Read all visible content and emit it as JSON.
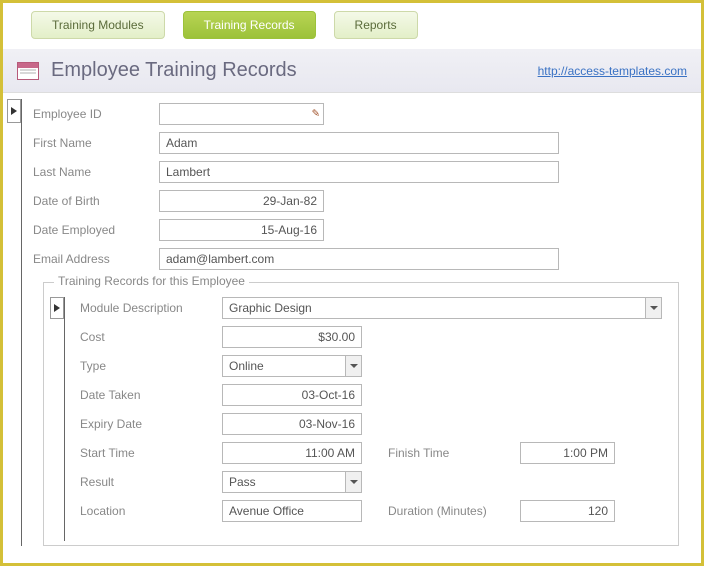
{
  "tabs": {
    "modules": "Training Modules",
    "records": "Training Records",
    "reports": "Reports"
  },
  "header": {
    "title": "Employee Training Records",
    "link": "http://access-templates.com"
  },
  "employee": {
    "labels": {
      "id": "Employee ID",
      "first_name": "First Name",
      "last_name": "Last Name",
      "dob": "Date of Birth",
      "date_employed": "Date Employed",
      "email": "Email Address"
    },
    "values": {
      "id": "",
      "first_name": "Adam",
      "last_name": "Lambert",
      "dob": "29-Jan-82",
      "date_employed": "15-Aug-16",
      "email": "adam@lambert.com"
    }
  },
  "training": {
    "legend": "Training Records for this Employee",
    "labels": {
      "module": "Module Description",
      "cost": "Cost",
      "type": "Type",
      "date_taken": "Date Taken",
      "expiry": "Expiry Date",
      "start": "Start Time",
      "finish": "Finish Time",
      "result": "Result",
      "location": "Location",
      "duration": "Duration (Minutes)"
    },
    "values": {
      "module": "Graphic Design",
      "cost": "$30.00",
      "type": "Online",
      "date_taken": "03-Oct-16",
      "expiry": "03-Nov-16",
      "start": "11:00 AM",
      "finish": "1:00 PM",
      "result": "Pass",
      "location": "Avenue Office",
      "duration": "120"
    }
  }
}
